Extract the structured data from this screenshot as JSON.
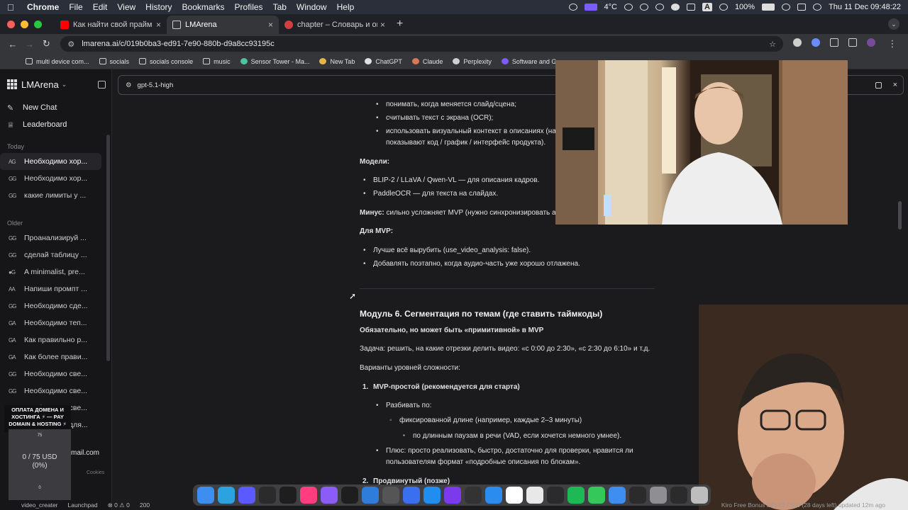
{
  "menubar": {
    "app": "Chrome",
    "items": [
      "File",
      "Edit",
      "View",
      "History",
      "Bookmarks",
      "Profiles",
      "Tab",
      "Window",
      "Help"
    ],
    "weather": "4°C",
    "battery": "100%",
    "datetime": "Thu 11 Dec  09:48:22",
    "input_letter": "A"
  },
  "tabs": [
    {
      "title": "Как найти свой прайм в",
      "favicon_color": "#ff0000"
    },
    {
      "title": "LMArena",
      "favicon_color": "#cfcfcf"
    },
    {
      "title": "chapter – Словарь и онлайн",
      "favicon_color": "#d04040"
    }
  ],
  "address": {
    "url": "lmarena.ai/c/019b0ba3-ed91-7e90-880b-d9a8cc93195c"
  },
  "bookmarks": [
    {
      "label": "multi device com...",
      "color": "#cfcfcf"
    },
    {
      "label": "socials",
      "color": "#cfcfcf"
    },
    {
      "label": "socials console",
      "color": "#cfcfcf"
    },
    {
      "label": "music",
      "color": "#cfcfcf"
    },
    {
      "label": "Sensor Tower - Ma...",
      "color": "#4fc3a1"
    },
    {
      "label": "New Tab",
      "color": "#e9b44c"
    },
    {
      "label": "ChatGPT",
      "color": "#e0e0e0"
    },
    {
      "label": "Claude",
      "color": "#d97757"
    },
    {
      "label": "Perplexity",
      "color": "#cfcfcf"
    },
    {
      "label": "Software and Gam...",
      "color": "#7b5cff"
    }
  ],
  "sidebar": {
    "brand": "LMArena",
    "nav": [
      {
        "label": "New Chat",
        "icon": "chat-icon"
      },
      {
        "label": "Leaderboard",
        "icon": "trophy-icon"
      }
    ],
    "today_label": "Today",
    "today": [
      {
        "label": "Необходимо хор...",
        "icon": "AG"
      },
      {
        "label": "Необходимо хор...",
        "icon": "GG"
      },
      {
        "label": "какие лимиты у ...",
        "icon": "GG"
      }
    ],
    "older_label": "Older",
    "older": [
      {
        "label": "Проанализируй ...",
        "icon": "GG"
      },
      {
        "label": "сделай таблицу ...",
        "icon": "GG"
      },
      {
        "label": "A minimalist, pre...",
        "icon": "●G"
      },
      {
        "label": "Напиши промпт ...",
        "icon": "AA"
      },
      {
        "label": "Необходимо сде...",
        "icon": "GG"
      },
      {
        "label": "Необходимо теп...",
        "icon": "GA"
      },
      {
        "label": "Как правильно р...",
        "icon": "GA"
      },
      {
        "label": "Как более прави...",
        "icon": "GA"
      },
      {
        "label": "Необходимо све...",
        "icon": "GG"
      },
      {
        "label": "Необходимо све...",
        "icon": "GG"
      },
      {
        "label": "Необходимо све...",
        "icon": "GG"
      },
      {
        "label": "Ты - эксперт для...",
        "icon": "GG"
      },
      {
        "label": "Что такое гугл ...",
        "icon": "GG"
      }
    ],
    "email_fragment": "mail.com",
    "cookies": "Cookies"
  },
  "promo": {
    "text": "ОПЛАТА ДОМЕНА И ХОСТИНГА ⚡ — PAY DOMAIN & HOSTING ⚡",
    "goal_top": "75",
    "amount": "0 / 75 USD",
    "percent": "(0%)",
    "goal_bottom": "0"
  },
  "header": {
    "model": "gpt-5.1-high"
  },
  "content": {
    "bullets_top": [
      "понимать, когда меняется слайд/сцена;",
      "считывать текст с экрана (OCR);",
      "использовать визуальный контекст в описаниях (на",
      "показывают код / график / интерфейс продукта)."
    ],
    "models_label": "Модели:",
    "models": [
      "BLIP-2 / LLaVA / Qwen-VL — для описания кадров.",
      "PaddleOCR — для текста на слайдах."
    ],
    "minus_label": "Минус:",
    "minus_text": "сильно усложняет MVP (нужно синхронизировать а",
    "mvp_label": "Для MVP:",
    "mvp": [
      "Лучше всё вырубить (use_video_analysis: false).",
      "Добавлять поэтапно, когда аудио-часть уже хорошо отлажена."
    ],
    "module_title": "Модуль 6. Сегментация по темам (где ставить таймкоды)",
    "module_sub": "Обязательно, но может быть «примитивной» в MVP",
    "task": "Задача: решить, на какие отрезки делить видео: «с 0:00 до 2:30», «с 2:30 до 6:10» и т.д.",
    "levels": "Варианты уровней сложности:",
    "item1_num": "1.",
    "item1": "MVP-простой (рекомендуется для старта)",
    "split_by": "Разбивать по:",
    "split1": "фиксированной длине (например, каждые 2–3 минуты)",
    "split2": "по длинным паузам в речи (VAD, если хочется немного умнее).",
    "plus1": "Плюс: просто реализовать, быстро, достаточно для проверки, нравится ли",
    "plus2": "пользователям формат «подробные описания по блокам».",
    "item2_num": "2.",
    "item2": "Продвинутый (позже)"
  },
  "dock": {
    "apps": [
      {
        "name": "finder",
        "color": "#3d8ef0"
      },
      {
        "name": "telegram",
        "color": "#2aa3e0"
      },
      {
        "name": "chat",
        "color": "#5a5aff"
      },
      {
        "name": "word",
        "color": "#2b2b2b"
      },
      {
        "name": "terminal",
        "color": "#1e1e1e"
      },
      {
        "name": "intellij",
        "color": "#ff3d7f"
      },
      {
        "name": "ghost",
        "color": "#8b5cf6"
      },
      {
        "name": "android",
        "color": "#1e1e1e"
      },
      {
        "name": "vscode",
        "color": "#2f7ddb"
      },
      {
        "name": "xcode-tool",
        "color": "#555"
      },
      {
        "name": "sketch",
        "color": "#3a6ff0"
      },
      {
        "name": "appstore",
        "color": "#1f8ef0"
      },
      {
        "name": "obsidian",
        "color": "#7c3aed"
      },
      {
        "name": "github",
        "color": "#333"
      },
      {
        "name": "safari",
        "color": "#2b8cf0"
      },
      {
        "name": "yandex",
        "color": "#ffffff"
      },
      {
        "name": "chrome",
        "color": "#e8e8e8"
      },
      {
        "name": "star",
        "color": "#2b2b2b"
      },
      {
        "name": "spotify",
        "color": "#1db954"
      },
      {
        "name": "messages",
        "color": "#34c759"
      },
      {
        "name": "mail",
        "color": "#3d8ef0"
      },
      {
        "name": "piano",
        "color": "#2b2b2b"
      },
      {
        "name": "settings",
        "color": "#8e8e93"
      },
      {
        "name": "figma",
        "color": "#2b2b2b"
      },
      {
        "name": "trash",
        "color": "#bdbdbd"
      }
    ]
  },
  "status": {
    "left": [
      "video_creater",
      "Launchpad",
      "⊗ 0 ⚠ 0",
      "200"
    ],
    "right": "Kiro Free Bonus 249.52 / 500 (28 days left) updated 12m ago"
  }
}
